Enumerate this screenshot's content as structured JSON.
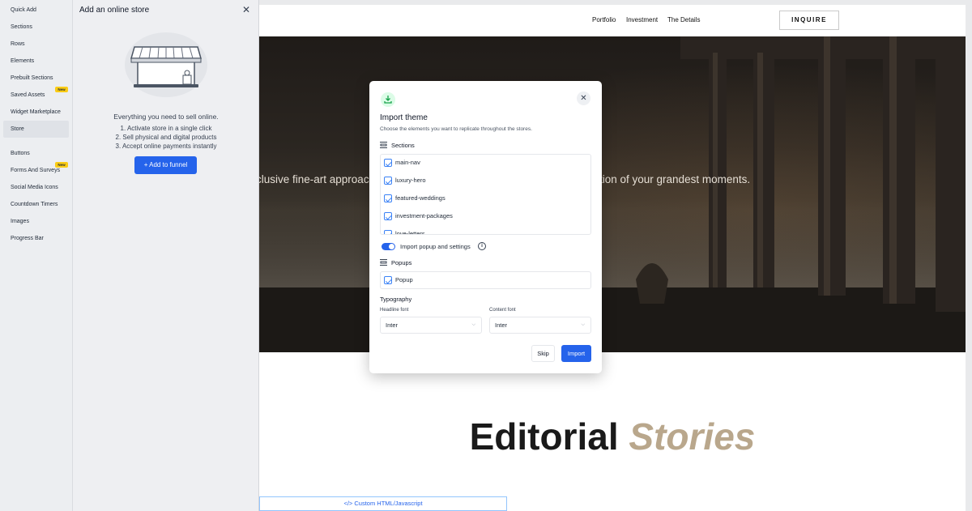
{
  "sidebar": {
    "items": [
      {
        "label": "Quick Add"
      },
      {
        "label": "Sections"
      },
      {
        "label": "Rows"
      },
      {
        "label": "Elements"
      },
      {
        "label": "Prebuilt Sections"
      },
      {
        "label": "Saved Assets",
        "badge": "New"
      },
      {
        "label": "Widget Marketplace"
      },
      {
        "label": "Store",
        "active": true
      },
      {
        "label": "Buttons"
      },
      {
        "label": "Forms And Surveys",
        "badge": "New"
      },
      {
        "label": "Social Media Icons"
      },
      {
        "label": "Countdown Timers"
      },
      {
        "label": "Images"
      },
      {
        "label": "Progress Bar"
      }
    ]
  },
  "store_panel": {
    "title": "Add an online store",
    "headline": "Everything you need to sell online.",
    "steps": [
      "1. Activate store in a single click",
      "2. Sell physical and digital products",
      "3. Accept online payments instantly"
    ],
    "button": "+ Add to funnel"
  },
  "site": {
    "nav": [
      "Portfolio",
      "Investment",
      "The Details"
    ],
    "cta": "INQUIRE",
    "hero_text_left": "clusive fine-art approach",
    "hero_text_right": "tion of your grandest moments.",
    "heading_main": "Editorial",
    "heading_accent": "Stories",
    "custom_html": "</> Custom HTML/Javascript"
  },
  "modal": {
    "title": "Import theme",
    "subtitle": "Choose the elements you want to replicate throughout the stores.",
    "sections_label": "Sections",
    "sections": [
      "main-nav",
      "luxury-hero",
      "featured-weddings",
      "investment-packages",
      "love-letters"
    ],
    "toggle_label": "Import popup and settings",
    "toggle_on": true,
    "popups_label": "Popups",
    "popups": [
      "Popup"
    ],
    "typography_label": "Typography",
    "headline_font_label": "Headline font",
    "headline_font": "Inter",
    "content_font_label": "Content font",
    "content_font": "Inter",
    "skip_label": "Skip",
    "import_label": "Import"
  },
  "colors": {
    "accent": "#2563eb",
    "new_badge": "#facc15",
    "heading_accent": "#b9a78c"
  }
}
